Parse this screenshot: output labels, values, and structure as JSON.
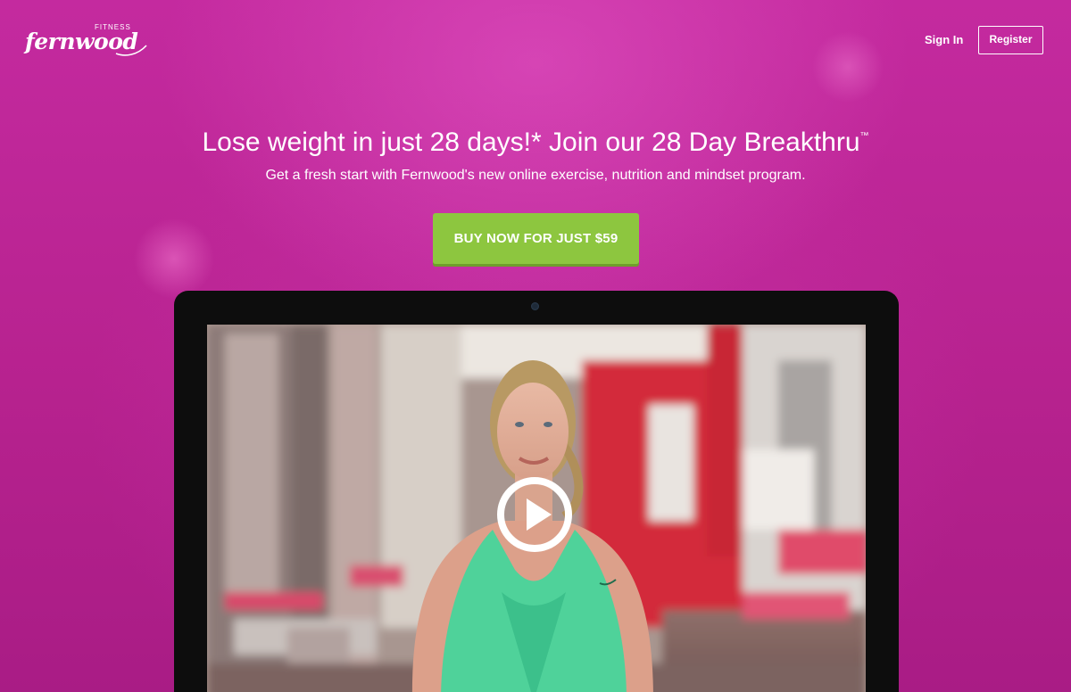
{
  "header": {
    "logo_small": "FITNESS",
    "logo_word": "fernwood",
    "signin_label": "Sign In",
    "register_label": "Register"
  },
  "hero": {
    "headline": "Lose weight in just 28 days!* Join our 28 Day Breakthru",
    "headline_mark": "™",
    "subhead": "Get a fresh start with Fernwood's new online exercise, nutrition and mindset program.",
    "cta_label": "BUY NOW FOR JUST $59"
  },
  "video": {
    "play_icon": "play-icon"
  },
  "colors": {
    "background": "#b5248f",
    "cta": "#8dc63f",
    "frame": "#0d0d0d"
  }
}
